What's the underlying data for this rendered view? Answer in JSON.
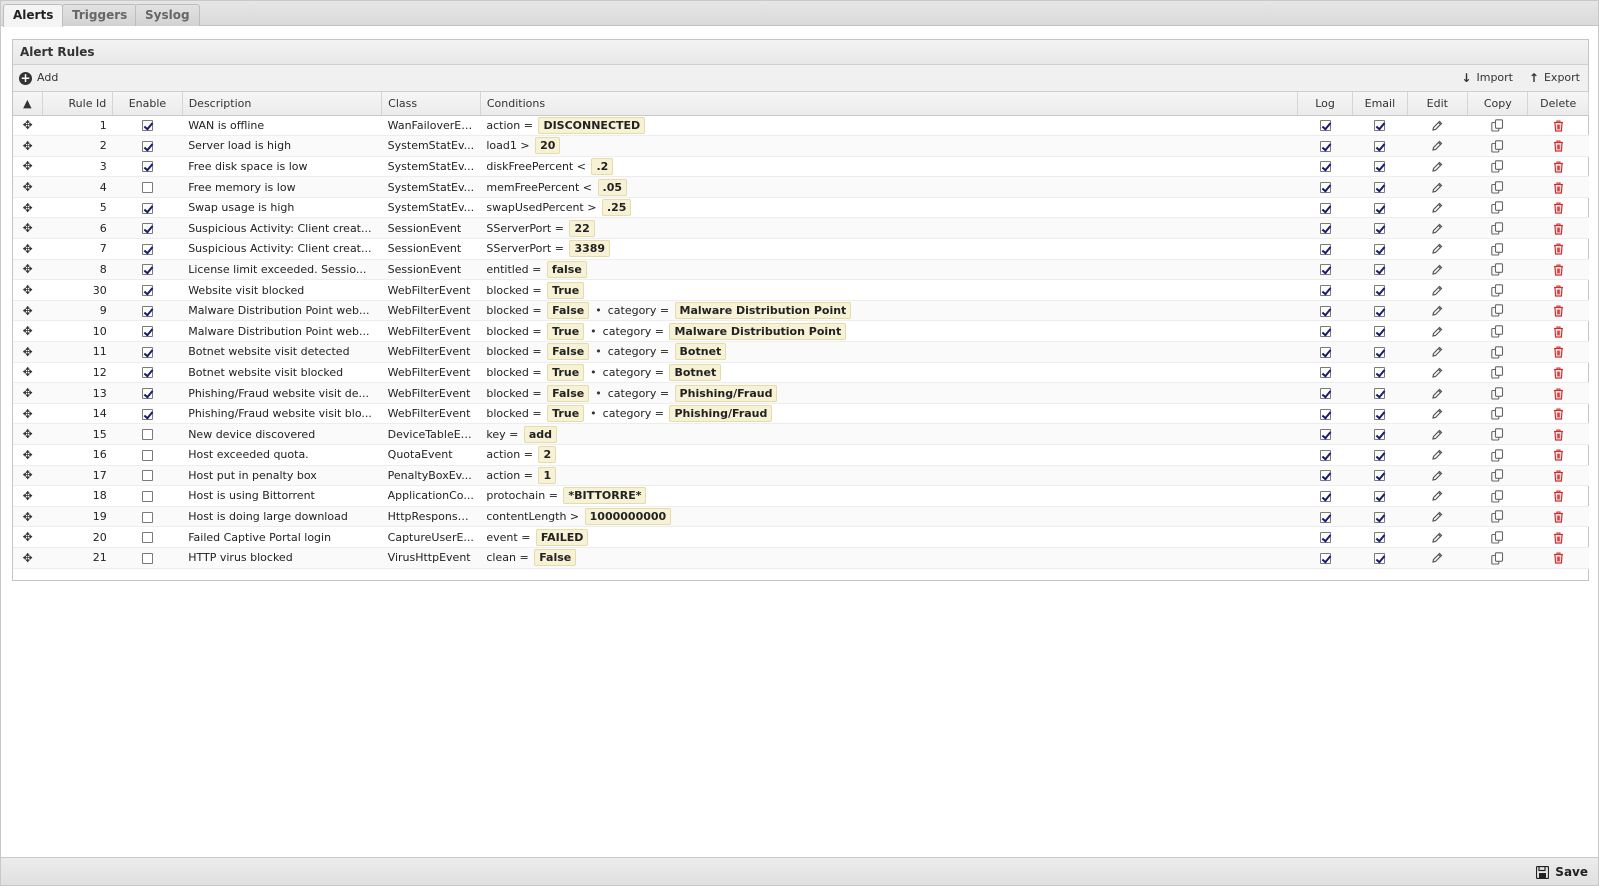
{
  "tabs": [
    {
      "label": "Alerts",
      "active": true
    },
    {
      "label": "Triggers",
      "active": false
    },
    {
      "label": "Syslog",
      "active": false
    }
  ],
  "panel": {
    "title": "Alert Rules",
    "add_label": "Add",
    "import_label": "Import",
    "export_label": "Export"
  },
  "columns": {
    "rule_id": "Rule Id",
    "enable": "Enable",
    "description": "Description",
    "class": "Class",
    "conditions": "Conditions",
    "log": "Log",
    "email": "Email",
    "edit": "Edit",
    "copy": "Copy",
    "delete": "Delete"
  },
  "rows": [
    {
      "id": "1",
      "enable": true,
      "description": "WAN is offline",
      "class": "WanFailoverEv...",
      "conditions": [
        {
          "field": "action =",
          "value": "DISCONNECTED"
        }
      ],
      "log": true,
      "email": true
    },
    {
      "id": "2",
      "enable": true,
      "description": "Server load is high",
      "class": "SystemStatEv...",
      "conditions": [
        {
          "field": "load1 >",
          "value": "20"
        }
      ],
      "log": true,
      "email": true
    },
    {
      "id": "3",
      "enable": true,
      "description": "Free disk space is low",
      "class": "SystemStatEv...",
      "conditions": [
        {
          "field": "diskFreePercent <",
          "value": ".2"
        }
      ],
      "log": true,
      "email": true
    },
    {
      "id": "4",
      "enable": false,
      "description": "Free memory is low",
      "class": "SystemStatEv...",
      "conditions": [
        {
          "field": "memFreePercent <",
          "value": ".05"
        }
      ],
      "log": true,
      "email": true
    },
    {
      "id": "5",
      "enable": true,
      "description": "Swap usage is high",
      "class": "SystemStatEv...",
      "conditions": [
        {
          "field": "swapUsedPercent >",
          "value": ".25"
        }
      ],
      "log": true,
      "email": true
    },
    {
      "id": "6",
      "enable": true,
      "description": "Suspicious Activity: Client creat...",
      "class": "SessionEvent",
      "conditions": [
        {
          "field": "SServerPort =",
          "value": "22"
        }
      ],
      "log": true,
      "email": true
    },
    {
      "id": "7",
      "enable": true,
      "description": "Suspicious Activity: Client creat...",
      "class": "SessionEvent",
      "conditions": [
        {
          "field": "SServerPort =",
          "value": "3389"
        }
      ],
      "log": true,
      "email": true
    },
    {
      "id": "8",
      "enable": true,
      "description": "License limit exceeded. Sessio...",
      "class": "SessionEvent",
      "conditions": [
        {
          "field": "entitled =",
          "value": "false"
        }
      ],
      "log": true,
      "email": true
    },
    {
      "id": "30",
      "enable": true,
      "description": "Website visit blocked",
      "class": "WebFilterEvent",
      "conditions": [
        {
          "field": "blocked =",
          "value": "True"
        }
      ],
      "log": true,
      "email": true
    },
    {
      "id": "9",
      "enable": true,
      "description": "Malware Distribution Point web...",
      "class": "WebFilterEvent",
      "conditions": [
        {
          "field": "blocked =",
          "value": "False"
        },
        {
          "field": "category =",
          "value": "Malware Distribution Point"
        }
      ],
      "log": true,
      "email": true
    },
    {
      "id": "10",
      "enable": true,
      "description": "Malware Distribution Point web...",
      "class": "WebFilterEvent",
      "conditions": [
        {
          "field": "blocked =",
          "value": "True"
        },
        {
          "field": "category =",
          "value": "Malware Distribution Point"
        }
      ],
      "log": true,
      "email": true
    },
    {
      "id": "11",
      "enable": true,
      "description": "Botnet website visit detected",
      "class": "WebFilterEvent",
      "conditions": [
        {
          "field": "blocked =",
          "value": "False"
        },
        {
          "field": "category =",
          "value": "Botnet"
        }
      ],
      "log": true,
      "email": true
    },
    {
      "id": "12",
      "enable": true,
      "description": "Botnet website visit blocked",
      "class": "WebFilterEvent",
      "conditions": [
        {
          "field": "blocked =",
          "value": "True"
        },
        {
          "field": "category =",
          "value": "Botnet"
        }
      ],
      "log": true,
      "email": true
    },
    {
      "id": "13",
      "enable": true,
      "description": "Phishing/Fraud website visit de...",
      "class": "WebFilterEvent",
      "conditions": [
        {
          "field": "blocked =",
          "value": "False"
        },
        {
          "field": "category =",
          "value": "Phishing/Fraud"
        }
      ],
      "log": true,
      "email": true
    },
    {
      "id": "14",
      "enable": true,
      "description": "Phishing/Fraud website visit blo...",
      "class": "WebFilterEvent",
      "conditions": [
        {
          "field": "blocked =",
          "value": "True"
        },
        {
          "field": "category =",
          "value": "Phishing/Fraud"
        }
      ],
      "log": true,
      "email": true
    },
    {
      "id": "15",
      "enable": false,
      "description": "New device discovered",
      "class": "DeviceTableEv...",
      "conditions": [
        {
          "field": "key =",
          "value": "add"
        }
      ],
      "log": true,
      "email": true
    },
    {
      "id": "16",
      "enable": false,
      "description": "Host exceeded quota.",
      "class": "QuotaEvent",
      "conditions": [
        {
          "field": "action =",
          "value": "2"
        }
      ],
      "log": true,
      "email": true
    },
    {
      "id": "17",
      "enable": false,
      "description": "Host put in penalty box",
      "class": "PenaltyBoxEv...",
      "conditions": [
        {
          "field": "action =",
          "value": "1"
        }
      ],
      "log": true,
      "email": true
    },
    {
      "id": "18",
      "enable": false,
      "description": "Host is using Bittorrent",
      "class": "ApplicationCo...",
      "conditions": [
        {
          "field": "protochain =",
          "value": "*BITTORRE*"
        }
      ],
      "log": true,
      "email": true
    },
    {
      "id": "19",
      "enable": false,
      "description": "Host is doing large download",
      "class": "HttpResponse...",
      "conditions": [
        {
          "field": "contentLength >",
          "value": "1000000000"
        }
      ],
      "log": true,
      "email": true
    },
    {
      "id": "20",
      "enable": false,
      "description": "Failed Captive Portal login",
      "class": "CaptureUserE...",
      "conditions": [
        {
          "field": "event =",
          "value": "FAILED"
        }
      ],
      "log": true,
      "email": true
    },
    {
      "id": "21",
      "enable": false,
      "description": "HTTP virus blocked",
      "class": "VirusHttpEvent",
      "conditions": [
        {
          "field": "clean =",
          "value": "False"
        }
      ],
      "log": true,
      "email": true
    }
  ],
  "footer": {
    "save_label": "Save"
  },
  "colors": {
    "condition_value_bg": "#f7f2d6",
    "delete_icon": "#d62b2b"
  }
}
